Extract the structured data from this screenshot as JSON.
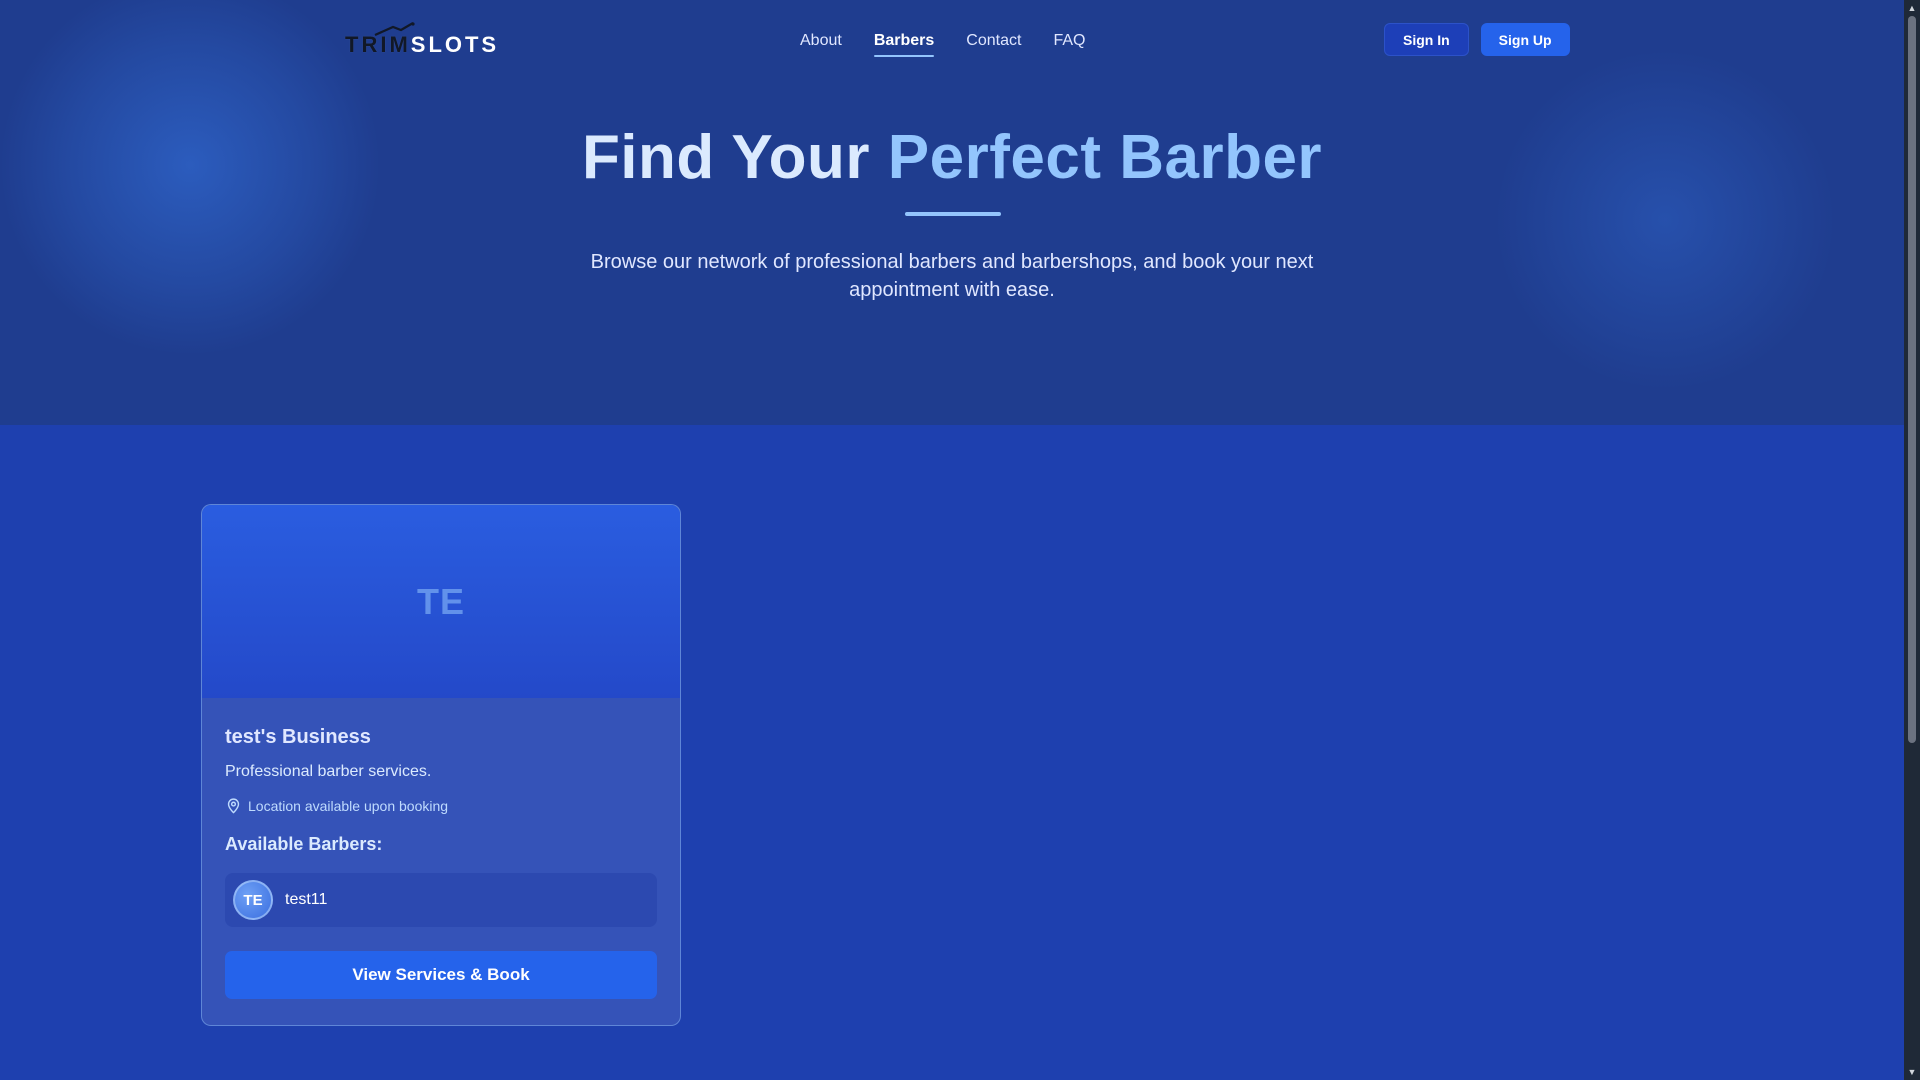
{
  "nav": {
    "logo": {
      "part1": "TRIM",
      "part2": "SLOTS"
    },
    "links": [
      {
        "label": "About",
        "active": false
      },
      {
        "label": "Barbers",
        "active": true
      },
      {
        "label": "Contact",
        "active": false
      },
      {
        "label": "FAQ",
        "active": false
      }
    ],
    "sign_in_label": "Sign In",
    "sign_up_label": "Sign Up"
  },
  "hero": {
    "title_part1": "Find Your",
    "title_part2": "Perfect Barber",
    "subtitle": "Browse our network of professional barbers and barbershops, and book your next appointment with ease."
  },
  "card": {
    "banner_initials": "TE",
    "title": "test's Business",
    "description": "Professional barber services.",
    "location": "Location available upon booking",
    "location_icon": "map-pin-icon",
    "barbers_label": "Available Barbers:",
    "barbers": [
      {
        "initials": "TE",
        "name": "test11"
      }
    ],
    "book_label": "View Services & Book"
  },
  "colors": {
    "hero_bg": "#1f3d8f",
    "main_bg": "#1e40af",
    "accent": "#93c5fd",
    "primary_button": "#2563eb"
  }
}
